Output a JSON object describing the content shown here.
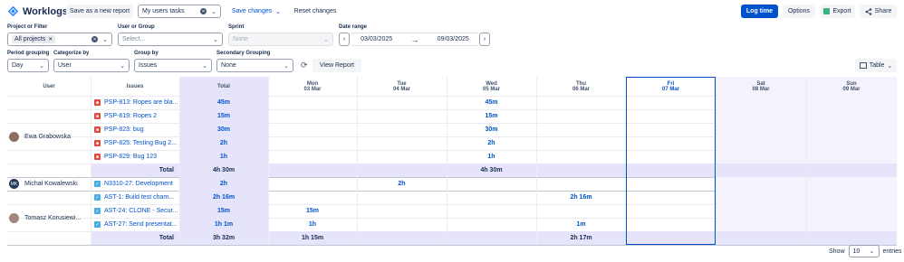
{
  "app": {
    "title": "Worklogs",
    "logo_icon": "worklogs-logo-icon"
  },
  "toolbar": {
    "save_as_new": "Save as a new report",
    "report_select": "My users tasks",
    "save_changes": "Save changes",
    "reset_changes": "Reset changes",
    "log_time": "Log time",
    "options": "Options",
    "export": "Export",
    "share": "Share"
  },
  "filters": {
    "project_label": "Project or Filter",
    "project_chip": "All projects",
    "user_label": "User or Group",
    "user_placeholder": "Select...",
    "sprint_label": "Sprint",
    "sprint_value": "None",
    "date_label": "Date range",
    "date_from": "03/03/2025",
    "date_to": "09/03/2025",
    "period_label": "Period grouping",
    "period_value": "Day",
    "categorize_label": "Categorize by",
    "categorize_value": "User",
    "groupby_label": "Group by",
    "groupby_value": "Issues",
    "secondary_label": "Secondary Grouping",
    "secondary_value": "None",
    "view_report": "View Report",
    "view_mode": "Table"
  },
  "table": {
    "headers": {
      "user": "User",
      "issues": "Issues",
      "total": "Total",
      "days": [
        {
          "dow": "Mon",
          "date": "03 Mar"
        },
        {
          "dow": "Tue",
          "date": "04 Mar"
        },
        {
          "dow": "Wed",
          "date": "05 Mar"
        },
        {
          "dow": "Thu",
          "date": "06 Mar"
        },
        {
          "dow": "Fri",
          "date": "07 Mar"
        },
        {
          "dow": "Sat",
          "date": "08 Mar"
        },
        {
          "dow": "Sun",
          "date": "09 Mar"
        }
      ]
    },
    "groups": [
      {
        "user": "Ewa Grabowska",
        "avatar_initials": "",
        "rows": [
          {
            "type": "bug",
            "issue": "PSP-813: Ropes are bla...",
            "total": "45m",
            "days": [
              "",
              "",
              "45m",
              "",
              "",
              "",
              ""
            ]
          },
          {
            "type": "bug",
            "issue": "PSP-819: Ropes 2",
            "total": "15m",
            "days": [
              "",
              "",
              "15m",
              "",
              "",
              "",
              ""
            ]
          },
          {
            "type": "bug",
            "issue": "PSP-823: bug",
            "total": "30m",
            "days": [
              "",
              "",
              "30m",
              "",
              "",
              "",
              ""
            ]
          },
          {
            "type": "bug",
            "issue": "PSP-825: Testing Bug 2...",
            "total": "2h",
            "days": [
              "",
              "",
              "2h",
              "",
              "",
              "",
              ""
            ]
          },
          {
            "type": "bug",
            "issue": "PSP-829: Bug 123",
            "total": "1h",
            "days": [
              "",
              "",
              "1h",
              "",
              "",
              "",
              ""
            ]
          }
        ],
        "total_label": "Total",
        "total": "4h 30m",
        "total_days": [
          "",
          "",
          "4h 30m",
          "",
          "",
          "",
          ""
        ]
      },
      {
        "user": "Michał Kowalewski",
        "avatar_initials": "MK",
        "rows": [
          {
            "type": "story",
            "issue": "N3310-27: Development",
            "total": "2h",
            "days": [
              "",
              "2h",
              "",
              "",
              "",
              "",
              ""
            ]
          }
        ]
      },
      {
        "user": "Tomasz Korusiewi...",
        "avatar_initials": "",
        "rows": [
          {
            "type": "task",
            "issue": "AST-1: Build test cham...",
            "total": "2h 16m",
            "days": [
              "",
              "",
              "",
              "2h 16m",
              "",
              "",
              ""
            ]
          },
          {
            "type": "story",
            "issue": "AST-24: CLONE - Secur...",
            "total": "15m",
            "days": [
              "15m",
              "",
              "",
              "",
              "",
              "",
              ""
            ]
          },
          {
            "type": "story",
            "issue": "AST-27: Send presentat...",
            "total": "1h 1m",
            "days": [
              "1h",
              "",
              "",
              "1m",
              "",
              "",
              ""
            ]
          }
        ],
        "total_label": "Total",
        "total": "3h 32m",
        "total_days": [
          "1h 15m",
          "",
          "",
          "2h 17m",
          "",
          "",
          ""
        ]
      }
    ]
  },
  "footer": {
    "show_label": "Show",
    "page_size": "10",
    "entries_label": "entries"
  },
  "colors": {
    "accent": "#0052cc",
    "total_col": "#e6e4fb",
    "today_border": "#0052cc",
    "bug": "#e5493a",
    "task": "#4bade8"
  }
}
